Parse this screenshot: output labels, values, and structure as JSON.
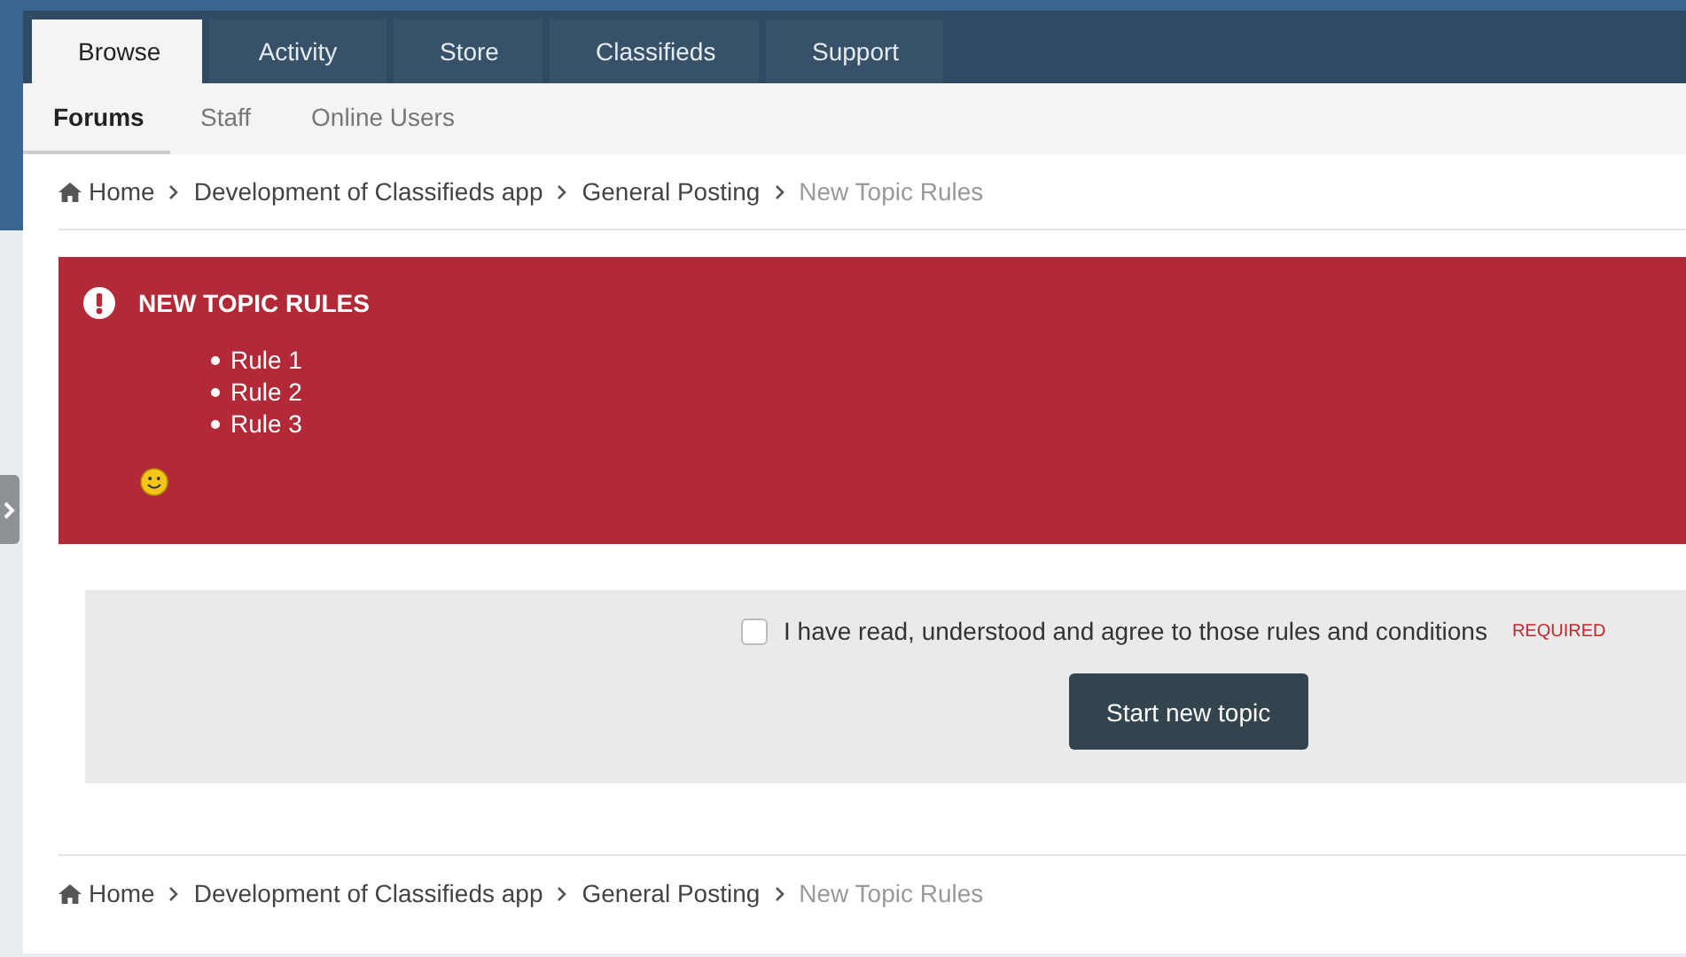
{
  "nav_tabs": [
    {
      "label": "Browse",
      "selected": true
    },
    {
      "label": "Activity",
      "selected": false
    },
    {
      "label": "Store",
      "selected": false
    },
    {
      "label": "Classifieds",
      "selected": false
    },
    {
      "label": "Support",
      "selected": false
    }
  ],
  "sub_tabs": [
    {
      "label": "Forums",
      "selected": true
    },
    {
      "label": "Staff",
      "selected": false
    },
    {
      "label": "Online Users",
      "selected": false
    }
  ],
  "breadcrumb_top": [
    {
      "label": "Home",
      "current": false
    },
    {
      "label": "Development of Classifieds app",
      "current": false
    },
    {
      "label": "General Posting",
      "current": false
    },
    {
      "label": "New Topic Rules",
      "current": true
    }
  ],
  "alert": {
    "title": "NEW TOPIC RULES",
    "rules": [
      "Rule 1",
      "Rule 2",
      "Rule 3"
    ]
  },
  "agreement": {
    "label": "I have read, understood and agree to those rules and conditions",
    "checked": false,
    "required": "REQUIRED",
    "button": "Start new topic"
  },
  "breadcrumb_bottom": [
    {
      "label": "Home",
      "current": false
    },
    {
      "label": "Development of Classifieds app",
      "current": false
    },
    {
      "label": "General Posting",
      "current": false
    },
    {
      "label": "New Topic Rules",
      "current": true
    }
  ]
}
